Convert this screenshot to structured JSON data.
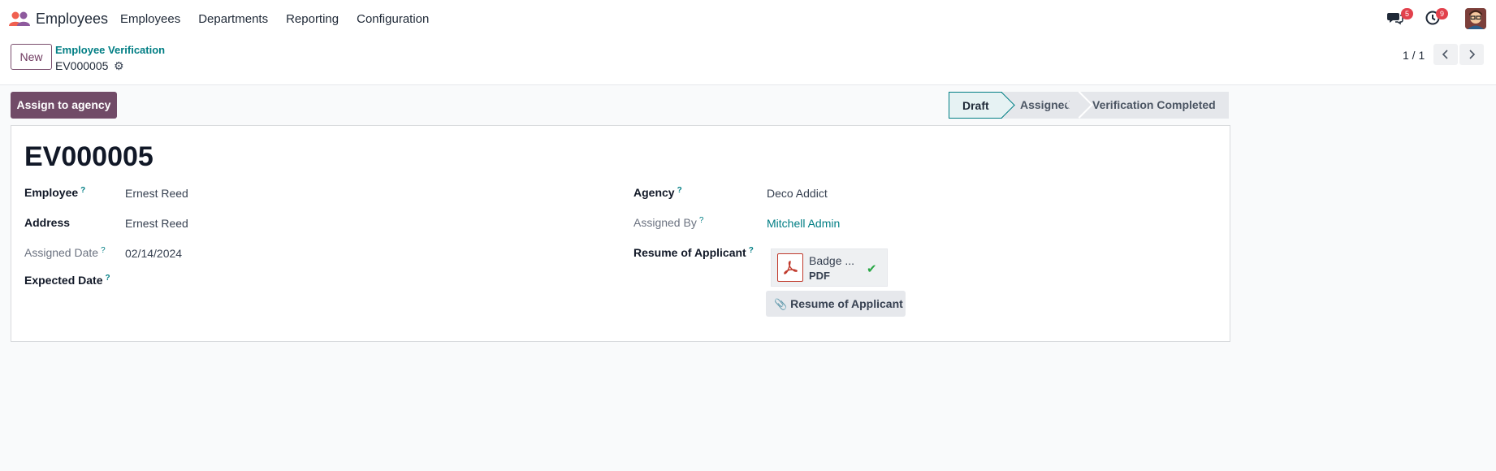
{
  "navbar": {
    "app_name": "Employees",
    "menu": [
      "Employees",
      "Departments",
      "Reporting",
      "Configuration"
    ],
    "messages_badge": "5",
    "activities_badge": "9"
  },
  "control_panel": {
    "new_label": "New",
    "breadcrumb": "Employee Verification",
    "record": "EV000005",
    "pager": "1 / 1"
  },
  "statusbar": {
    "action_label": "Assign to agency",
    "stages": [
      "Draft",
      "Assigned",
      "Verification Completed"
    ],
    "active_stage": "Draft"
  },
  "form": {
    "title": "EV000005",
    "left": {
      "employee_label": "Employee",
      "employee_value": "Ernest Reed",
      "address_label": "Address",
      "address_value": "Ernest Reed",
      "assigned_date_label": "Assigned Date",
      "assigned_date_value": "02/14/2024",
      "expected_date_label": "Expected Date"
    },
    "right": {
      "agency_label": "Agency",
      "agency_value": "Deco Addict",
      "assigned_by_label": "Assigned By",
      "assigned_by_value": "Mitchell Admin",
      "resume_label": "Resume of Applicant",
      "attachment_name": "Badge ...",
      "attachment_ext": "PDF",
      "upload_label": "Resume of Applicant"
    },
    "help_mark": "?"
  },
  "colors": {
    "brand": "#714b67",
    "link": "#017e84",
    "badge": "#e2414c"
  }
}
